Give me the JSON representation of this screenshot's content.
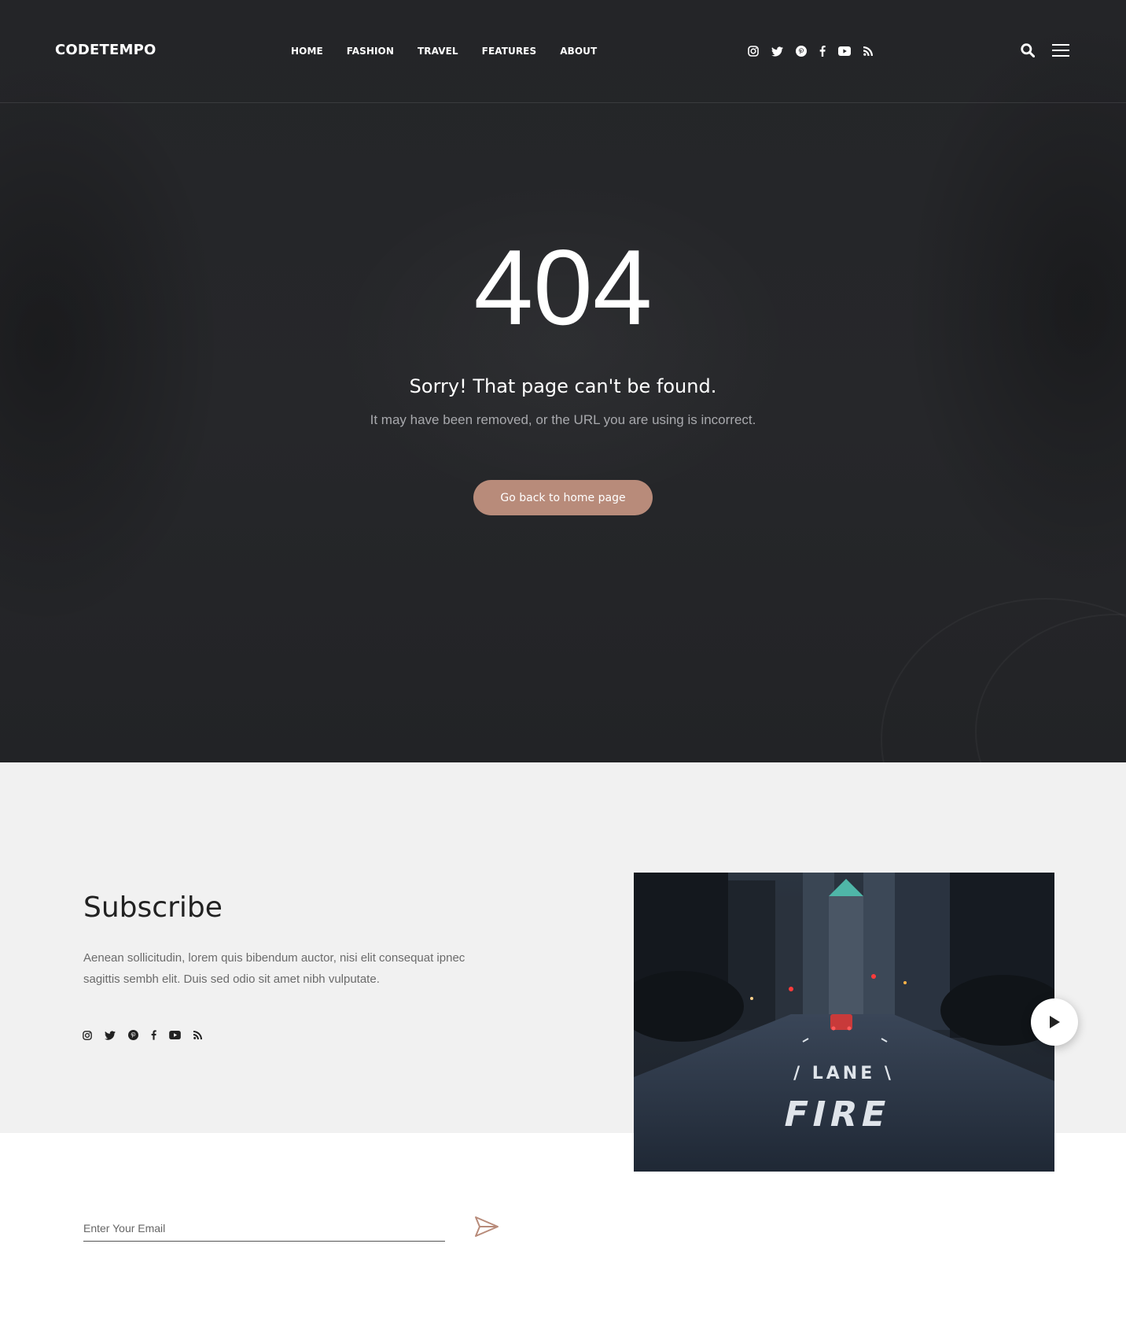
{
  "header": {
    "logo": "CODETEMPO",
    "nav": [
      "HOME",
      "FASHION",
      "TRAVEL",
      "FEATURES",
      "ABOUT"
    ],
    "social_icons": [
      "instagram-icon",
      "twitter-icon",
      "pinterest-icon",
      "facebook-icon",
      "youtube-icon",
      "rss-icon"
    ],
    "tools": [
      "search-icon",
      "menu-icon"
    ]
  },
  "error": {
    "code": "404",
    "title": "Sorry! That page can't be found.",
    "subtitle": "It may have been removed, or the URL you are using is incorrect.",
    "button_label": "Go back to home page"
  },
  "subscribe": {
    "title": "Subscribe",
    "text": "Aenean sollicitudin, lorem quis bibendum auctor, nisi elit consequat ipnec sagittis sembh elit. Duis sed odio sit amet nibh vulputate.",
    "social_icons": [
      "instagram-icon",
      "twitter-icon",
      "pinterest-icon",
      "facebook-icon",
      "youtube-icon",
      "rss-icon"
    ],
    "email_placeholder": "Enter Your Email",
    "photo_text_line1": "/ LANE \\",
    "photo_text_line2": "FIRE"
  },
  "colors": {
    "hero_bg": "#232427",
    "accent": "#b88b7a",
    "subscribe_bg": "#f1f1f1"
  }
}
